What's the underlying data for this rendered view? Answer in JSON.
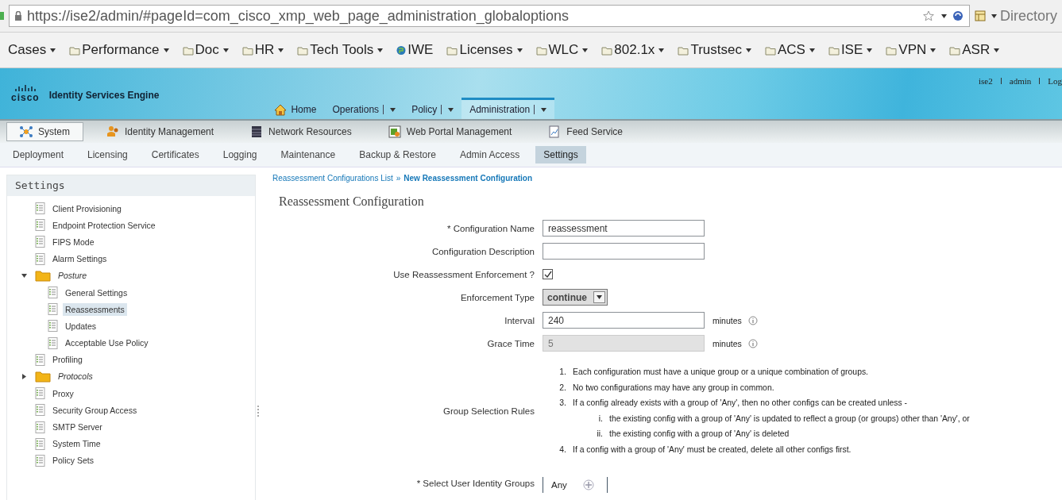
{
  "browser": {
    "url": "https://ise2/admin/#pageId=com_cisco_xmp_web_page_administration_globaloptions",
    "directory": "Directory",
    "bookmarks": [
      {
        "label": "Cases",
        "kind": "plain",
        "dropdown": true
      },
      {
        "label": "Performance",
        "kind": "folder",
        "dropdown": true
      },
      {
        "label": "Doc",
        "kind": "folder",
        "dropdown": true
      },
      {
        "label": "HR",
        "kind": "folder",
        "dropdown": true
      },
      {
        "label": "Tech Tools",
        "kind": "folder",
        "dropdown": true
      },
      {
        "label": "IWE",
        "kind": "site",
        "dropdown": false
      },
      {
        "label": "Licenses",
        "kind": "folder",
        "dropdown": true
      },
      {
        "label": "WLC",
        "kind": "folder",
        "dropdown": true
      },
      {
        "label": "802.1x",
        "kind": "folder",
        "dropdown": true
      },
      {
        "label": "Trustsec",
        "kind": "folder",
        "dropdown": true
      },
      {
        "label": "ACS",
        "kind": "folder",
        "dropdown": true
      },
      {
        "label": "ISE",
        "kind": "folder",
        "dropdown": true
      },
      {
        "label": "VPN",
        "kind": "folder",
        "dropdown": true
      },
      {
        "label": "ASR",
        "kind": "folder",
        "dropdown": true
      }
    ]
  },
  "header": {
    "logo": "cisco",
    "product": "Identity Services Engine",
    "user_links": [
      "ise2",
      "admin",
      "Log"
    ],
    "main_nav": [
      {
        "label": "Home",
        "kind": "home",
        "dropdown": false,
        "selected": false
      },
      {
        "label": "Operations",
        "kind": "menu",
        "dropdown": true,
        "selected": false
      },
      {
        "label": "Policy",
        "kind": "menu",
        "dropdown": true,
        "selected": false
      },
      {
        "label": "Administration",
        "kind": "menu",
        "dropdown": true,
        "selected": true
      }
    ]
  },
  "section_tabs": [
    {
      "label": "System",
      "kind": "system",
      "selected": true
    },
    {
      "label": "Identity Management",
      "kind": "identity",
      "selected": false
    },
    {
      "label": "Network Resources",
      "kind": "network",
      "selected": false
    },
    {
      "label": "Web Portal Management",
      "kind": "portal",
      "selected": false
    },
    {
      "label": "Feed Service",
      "kind": "feed",
      "selected": false
    }
  ],
  "sub_tabs": [
    {
      "label": "Deployment",
      "selected": false
    },
    {
      "label": "Licensing",
      "selected": false
    },
    {
      "label": "Certificates",
      "selected": false
    },
    {
      "label": "Logging",
      "selected": false
    },
    {
      "label": "Maintenance",
      "selected": false
    },
    {
      "label": "Backup & Restore",
      "selected": false
    },
    {
      "label": "Admin Access",
      "selected": false
    },
    {
      "label": "Settings",
      "selected": true
    }
  ],
  "sidebar": {
    "title": "Settings",
    "items": [
      {
        "label": "Client Provisioning",
        "kind": "page",
        "selected": false
      },
      {
        "label": "Endpoint Protection Service",
        "kind": "page",
        "selected": false
      },
      {
        "label": "FIPS Mode",
        "kind": "page",
        "selected": false
      },
      {
        "label": "Alarm Settings",
        "kind": "page",
        "selected": false
      },
      {
        "label": "Posture",
        "kind": "folder",
        "selected": false,
        "expanded": true,
        "children": [
          {
            "label": "General Settings",
            "kind": "page",
            "selected": false
          },
          {
            "label": "Reassessments",
            "kind": "page",
            "selected": true
          },
          {
            "label": "Updates",
            "kind": "page",
            "selected": false
          },
          {
            "label": "Acceptable Use Policy",
            "kind": "page",
            "selected": false
          }
        ]
      },
      {
        "label": "Profiling",
        "kind": "page",
        "selected": false
      },
      {
        "label": "Protocols",
        "kind": "folder",
        "selected": false,
        "expanded": false
      },
      {
        "label": "Proxy",
        "kind": "page",
        "selected": false
      },
      {
        "label": "Security Group Access",
        "kind": "page",
        "selected": false
      },
      {
        "label": "SMTP Server",
        "kind": "page",
        "selected": false
      },
      {
        "label": "System Time",
        "kind": "page",
        "selected": false
      },
      {
        "label": "Policy Sets",
        "kind": "page",
        "selected": false
      }
    ]
  },
  "main": {
    "breadcrumb": {
      "items": [
        "Reassessment Configurations List",
        "New Reassessment Configuration"
      ],
      "separator": "»"
    },
    "heading": "Reassessment Configuration",
    "form": [
      {
        "kind": "text",
        "label": "* Configuration Name",
        "value": "reassessment",
        "disabled": false
      },
      {
        "kind": "text",
        "label": "Configuration Description",
        "disabled": false
      },
      {
        "kind": "checkbox",
        "label": "Use Reassessment Enforcement ?",
        "checked": true
      },
      {
        "kind": "select",
        "label": "Enforcement Type",
        "value": "continue"
      },
      {
        "kind": "text",
        "label": "Interval",
        "value": "240",
        "suffix": "minutes",
        "info": true,
        "disabled": false
      },
      {
        "kind": "text",
        "label": "Grace Time",
        "value": "5",
        "suffix": "minutes",
        "info": true,
        "disabled": true
      },
      {
        "kind": "rules",
        "label": "Group Selection Rules",
        "rules": [
          {
            "marker": "1.",
            "text": "Each configuration must have a unique group or a unique combination of groups."
          },
          {
            "marker": "2.",
            "text": "No two configurations may have any group in common."
          },
          {
            "marker": "3.",
            "text": "If a config already exists with a group of 'Any', then no other configs can be created unless -",
            "children": [
              {
                "marker": "i.",
                "text": "the existing config with a group of 'Any' is updated to reflect a group (or groups) other than 'Any', or"
              },
              {
                "marker": "ii.",
                "text": "the existing config with a group of 'Any' is deleted"
              }
            ]
          },
          {
            "marker": "4.",
            "text": "If a config with a group of 'Any' must be created, delete all other configs first."
          }
        ]
      },
      {
        "kind": "picker",
        "label": "* Select User Identity Groups",
        "value": "Any"
      }
    ]
  }
}
